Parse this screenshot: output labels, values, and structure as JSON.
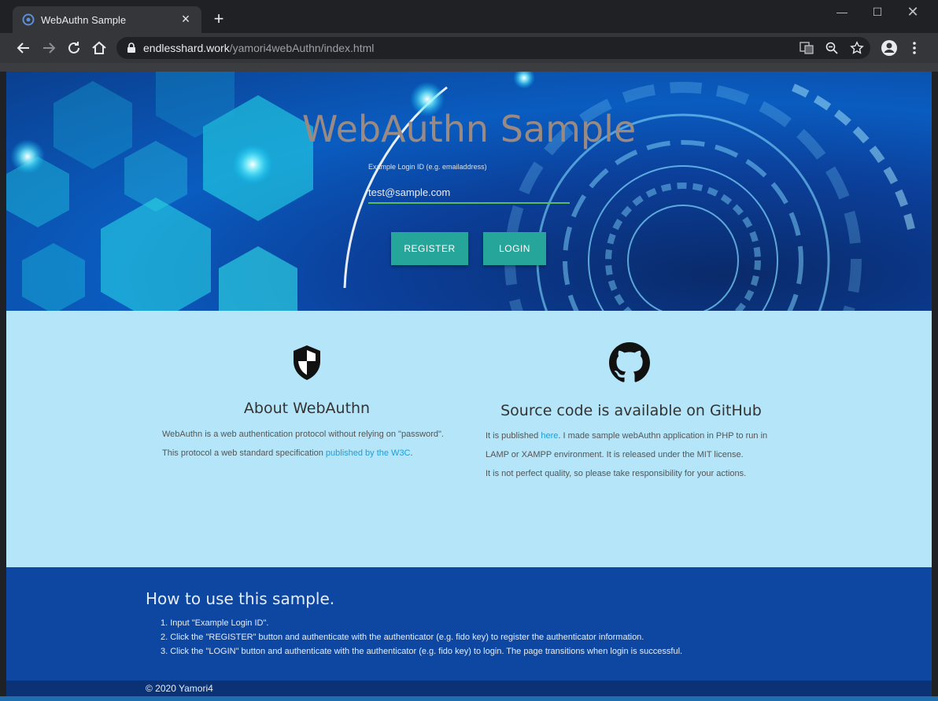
{
  "browser": {
    "tab_title": "WebAuthn Sample",
    "url_host": "endlesshard.work",
    "url_path": "/yamori4webAuthn/index.html"
  },
  "hero": {
    "title": "WebAuthn Sample",
    "login_label": "Example Login ID (e.g. emailaddress)",
    "login_value": "test@sample.com",
    "register_label": "REGISTER",
    "login_button_label": "LOGIN"
  },
  "about": {
    "title": "About WebAuthn",
    "text_1": "WebAuthn is a web authentication protocol without relying on \"password\". This protocol a web standard specification ",
    "link_text": "published by the W3C",
    "text_2": "."
  },
  "source": {
    "title": "Source code is available on GitHub",
    "text_1": "It is published ",
    "link_text": "here",
    "text_2": ". I made sample webAuthn application in PHP to run in LAMP or XAMPP environment. It is released under the MIT license.",
    "text_3": "It is not perfect quality, so please take responsibility for your actions."
  },
  "howto": {
    "title": "How to use this sample.",
    "steps": [
      "1. Input \"Example Login ID\".",
      "2. Click the \"REGISTER\" button and authenticate with the authenticator (e.g. fido key) to register the authenticator information.",
      "3. Click the \"LOGIN\" button and authenticate with the authenticator (e.g. fido key) to login. The page transitions when login is successful."
    ]
  },
  "footer": {
    "copyright": "© 2020 Yamori4"
  },
  "icons": [
    "shield-icon",
    "github-icon",
    "lock-icon",
    "translate-icon",
    "zoom-out-icon",
    "star-icon",
    "account-icon",
    "menu-icon"
  ]
}
